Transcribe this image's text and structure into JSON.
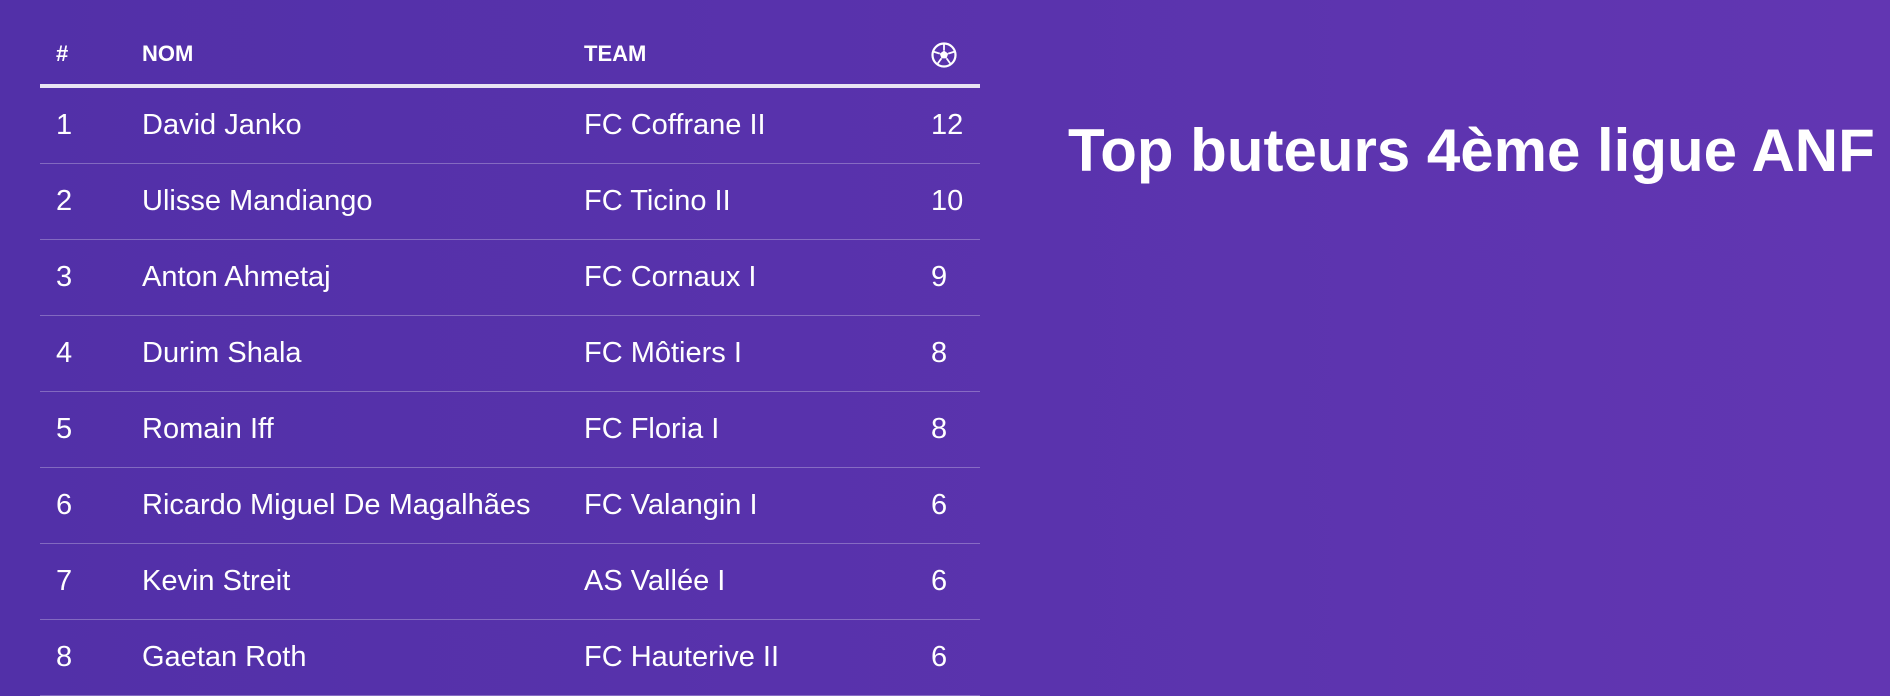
{
  "title": "Top buteurs 4ème ligue ANF",
  "table": {
    "headers": {
      "rank": "#",
      "name": "NOM",
      "team": "TEAM",
      "goals_icon": "soccer-ball-icon"
    },
    "rows": [
      {
        "rank": "1",
        "name": "David Janko",
        "team": "FC Coffrane II",
        "goals": "12"
      },
      {
        "rank": "2",
        "name": "Ulisse Mandiango",
        "team": "FC Ticino II",
        "goals": "10"
      },
      {
        "rank": "3",
        "name": "Anton Ahmetaj",
        "team": "FC Cornaux I",
        "goals": "9"
      },
      {
        "rank": "4",
        "name": "Durim Shala",
        "team": "FC Môtiers I",
        "goals": "8"
      },
      {
        "rank": "5",
        "name": "Romain Iff",
        "team": "FC Floria I",
        "goals": "8"
      },
      {
        "rank": "6",
        "name": "Ricardo Miguel De Magalhães",
        "team": "FC Valangin I",
        "goals": "6"
      },
      {
        "rank": "7",
        "name": "Kevin Streit",
        "team": "AS Vallée I",
        "goals": "6"
      },
      {
        "rank": "8",
        "name": "Gaetan Roth",
        "team": "FC Hauterive II",
        "goals": "6"
      }
    ]
  },
  "colors": {
    "background": "#5a33ad",
    "text": "#ffffff",
    "header_rule": "#e8e4f3"
  }
}
